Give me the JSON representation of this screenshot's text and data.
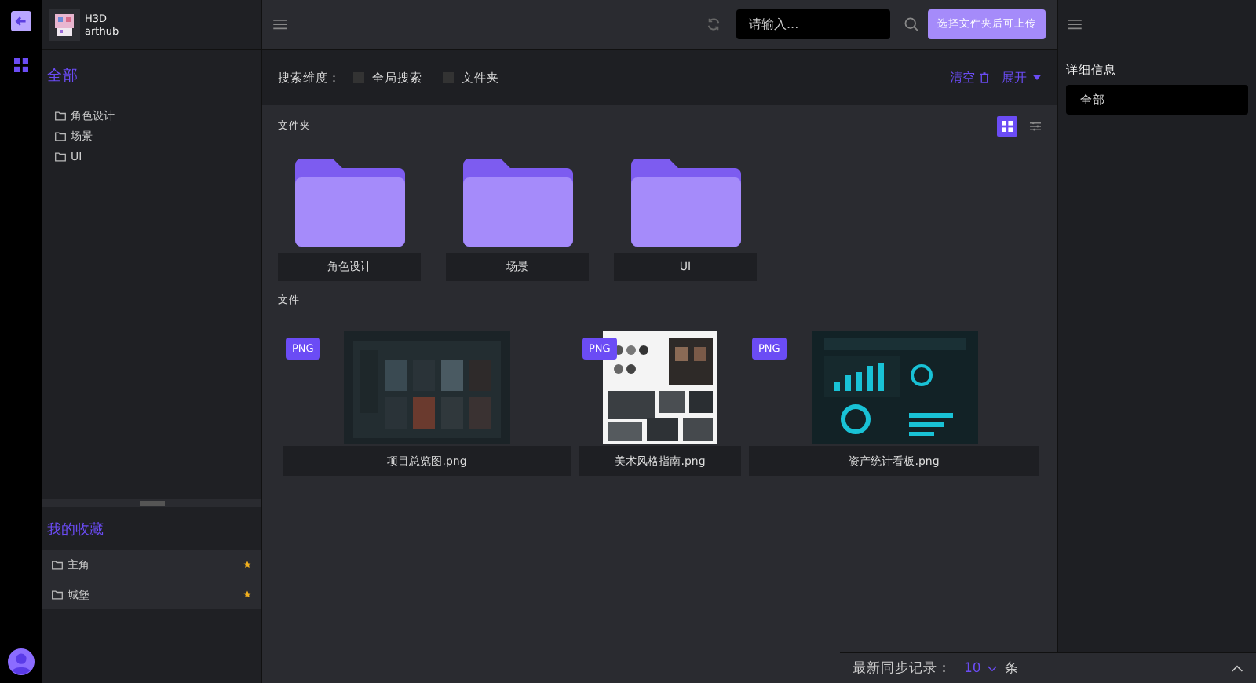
{
  "account": {
    "name": "H3D",
    "user": "arthub"
  },
  "toolbar": {
    "search_placeholder": "请输入...",
    "upload_button": "选择文件夹后可上传"
  },
  "tree": {
    "root": "全部",
    "items": [
      {
        "label": "角色设计"
      },
      {
        "label": "场景"
      },
      {
        "label": "UI"
      }
    ]
  },
  "favorites": {
    "title": "我的收藏",
    "items": [
      {
        "label": "主角",
        "starred": true
      },
      {
        "label": "城堡",
        "starred": true
      }
    ]
  },
  "filter": {
    "label": "搜索维度：",
    "options": [
      {
        "label": "全局搜索",
        "checked": false
      },
      {
        "label": "文件夹",
        "checked": false
      }
    ],
    "clear": "清空",
    "expand": "展开"
  },
  "folders_section": {
    "title": "文件夹",
    "view_modes": [
      {
        "kind": "grid",
        "selected": true
      },
      {
        "kind": "list",
        "selected": false
      }
    ]
  },
  "folders": [
    {
      "name": "角色设计"
    },
    {
      "name": "场景"
    },
    {
      "name": "UI"
    }
  ],
  "files_section": {
    "title": "文件"
  },
  "files": [
    {
      "name": "项目总览图.png",
      "type": "PNG"
    },
    {
      "name": "美术风格指南.png",
      "type": "PNG"
    },
    {
      "name": "资产统计看板.png",
      "type": "PNG"
    }
  ],
  "details": {
    "title": "详细信息",
    "value": "全部"
  },
  "sync": {
    "label": "最新同步记录：",
    "count": "10",
    "unit": "条"
  }
}
